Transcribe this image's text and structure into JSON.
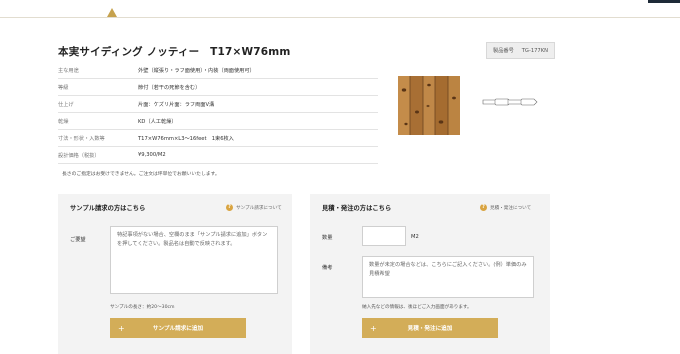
{
  "product": {
    "title": "本実サイディング ノッティー　T17×W76mm",
    "code_label": "製品番号",
    "code_value": "TG-177KN"
  },
  "specs": [
    {
      "key": "主な用途",
      "value": "外壁（縦張り・ラフ面使用）・内装（両面使用可）"
    },
    {
      "key": "等級",
      "value": "節付（若干の死節を含む）"
    },
    {
      "key": "仕上げ",
      "value": "片面：ケズリ片面：ラフ両面V溝"
    },
    {
      "key": "乾燥",
      "value": "KD（人工乾燥）"
    },
    {
      "key": "寸法・形状・入数等",
      "value": "T17×W76mm×L3～16feet　1束6枚入"
    },
    {
      "key": "設計価格（税抜）",
      "value": "¥9,300/M2"
    }
  ],
  "note": {
    "red": " ",
    "text": "長さのご指定はお受けできません。ご注文は坪単位でお願いいたします。"
  },
  "sample": {
    "heading": "サンプル請求の方はこちら",
    "link": "サンプル請求について",
    "field_label": "ご要望",
    "textarea_text": "特記事項がない場合、空欄のまま「サンプル請求に追加」ボタンを押してください。製品名は自動で反映されます。",
    "size_note": "サンプルの長さ：約20～30cm",
    "button": "サンプル請求に追加"
  },
  "quote": {
    "heading": "見積・発注の方はこちら",
    "link": "見積・発注について",
    "qty_label": "数量",
    "unit": "M2",
    "remarks_label": "備考",
    "textarea_text": "数量が未定の場合などは、こちらにご記入ください。(例）単価のみ見積希望",
    "hint": "納入先などの情報は、後ほどご入力画面があります。",
    "button": "見積・発注に追加"
  },
  "colors": {
    "accent": "#d3ad58",
    "note_red": "#c0392b",
    "panel_bg": "#f3f3f3"
  },
  "icons": [
    "question-circle-icon",
    "plus-icon",
    "tab-indicator-icon"
  ]
}
